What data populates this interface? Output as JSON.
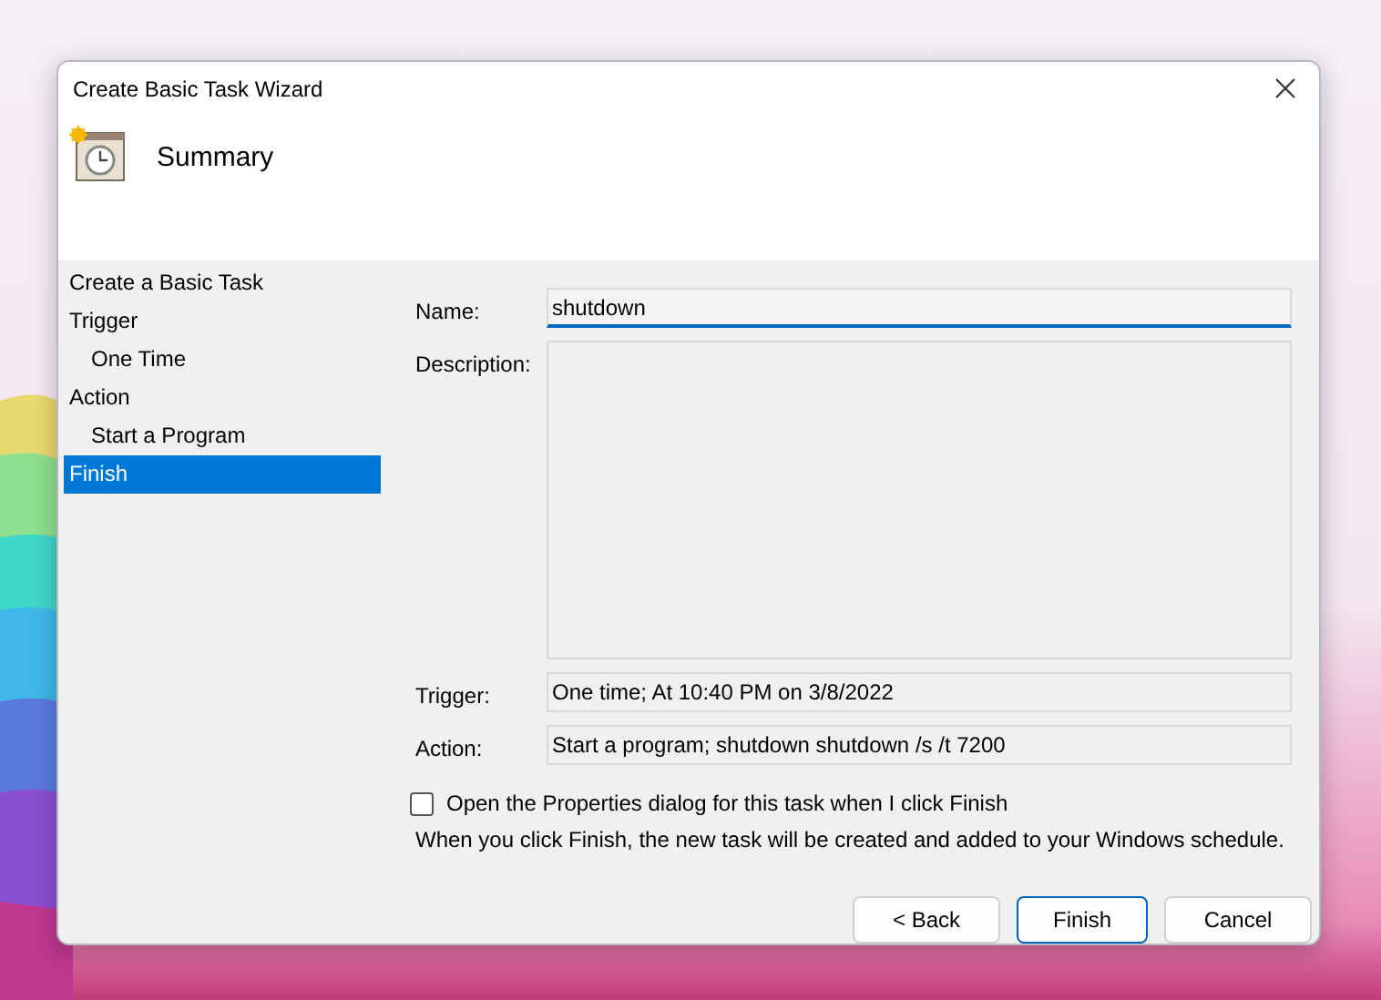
{
  "window": {
    "title": "Create Basic Task Wizard"
  },
  "header": {
    "title": "Summary"
  },
  "steps": [
    {
      "label": "Create a Basic Task",
      "selected": false
    },
    {
      "label": "Trigger",
      "selected": false,
      "children": [
        {
          "label": "One Time",
          "selected": false
        }
      ]
    },
    {
      "label": "Action",
      "selected": false,
      "children": [
        {
          "label": "Start a Program",
          "selected": false
        }
      ]
    },
    {
      "label": "Finish",
      "selected": true
    }
  ],
  "fields": [
    {
      "kind": "input",
      "label": "Name:",
      "value": "shutdown"
    },
    {
      "kind": "textarea",
      "label": "Description:"
    },
    {
      "kind": "readonly",
      "label": "Trigger:",
      "value": "One time; At 10:40 PM on 3/8/2022"
    },
    {
      "kind": "readonly",
      "label": "Action:",
      "value": "Start a program; shutdown shutdown /s /t 7200"
    }
  ],
  "checkbox": {
    "label": "Open the Properties dialog for this task when I click Finish",
    "checked": false
  },
  "note": "When you click Finish, the new task will be created and added to your Windows schedule.",
  "buttons": [
    {
      "label": "< Back",
      "default": false
    },
    {
      "label": "Finish",
      "default": true
    },
    {
      "label": "Cancel",
      "default": false
    }
  ]
}
